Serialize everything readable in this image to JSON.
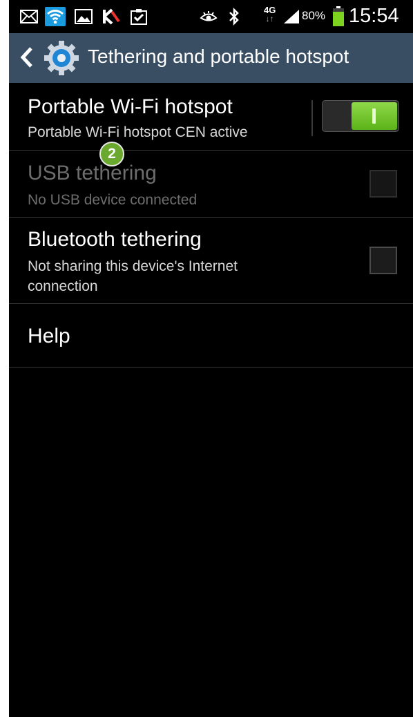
{
  "statusbar": {
    "battery_percent": "80%",
    "time": "15:54",
    "network_top": "4G",
    "network_bottom": "↓↑"
  },
  "actionbar": {
    "title": "Tethering and portable hotspot"
  },
  "settings": [
    {
      "title": "Portable Wi-Fi hotspot",
      "subtitle": "Portable Wi-Fi hotspot CEN active"
    },
    {
      "title": "USB tethering",
      "subtitle": "No USB device connected"
    },
    {
      "title": "Bluetooth tethering",
      "subtitle": "Not sharing this device's Internet connection"
    },
    {
      "title": "Help"
    }
  ],
  "annotation": {
    "step": "2"
  },
  "colors": {
    "actionbar": "#3a4e63",
    "toggle_on": "#6cc52a",
    "badge": "#6aa82e",
    "wifi_icon": "#1a9be0"
  }
}
